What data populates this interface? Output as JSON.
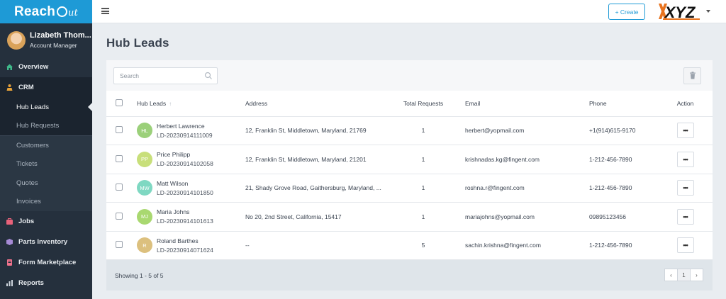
{
  "brand": {
    "name_part1": "Reach",
    "name_part2": "ut"
  },
  "user": {
    "name": "Lizabeth Thom...",
    "role": "Account Manager"
  },
  "nav": {
    "overview": "Overview",
    "crm": "CRM",
    "crm_sub": [
      "Hub Leads",
      "Hub Requests"
    ],
    "crm_other": [
      "Customers",
      "Tickets",
      "Quotes",
      "Invoices"
    ],
    "jobs": "Jobs",
    "parts": "Parts Inventory",
    "forms": "Form Marketplace",
    "reports": "Reports"
  },
  "topbar": {
    "create_label": "+ Create",
    "org_logo_text": "XYZ"
  },
  "page": {
    "title": "Hub Leads"
  },
  "search": {
    "placeholder": "Search"
  },
  "table": {
    "headers": {
      "lead": "Hub Leads",
      "address": "Address",
      "requests": "Total Requests",
      "email": "Email",
      "phone": "Phone",
      "action": "Action"
    },
    "rows": [
      {
        "initials": "HL",
        "color": "#9bd07a",
        "name": "Herbert Lawrence",
        "id": "LD-20230914111009",
        "address": "12, Franklin St, Middletown, Maryland, 21769",
        "requests": "1",
        "email": "herbert@yopmail.com",
        "phone": "+1(914)615-9170",
        "action": "•••"
      },
      {
        "initials": "PP",
        "color": "#c8df7a",
        "name": "Price Philipp",
        "id": "LD-20230914102058",
        "address": "12, Franklin St, Middletown, Maryland, 21201",
        "requests": "1",
        "email": "krishnadas.kg@fingent.com",
        "phone": "1-212-456-7890",
        "action": "•••"
      },
      {
        "initials": "MW",
        "color": "#7fd8c2",
        "name": "Matt Wilson",
        "id": "LD-20230914101850",
        "address": "21, Shady Grove Road, Gaithersburg, Maryland, ...",
        "requests": "1",
        "email": "roshna.r@fingent.com",
        "phone": "1-212-456-7890",
        "action": "•••"
      },
      {
        "initials": "MJ",
        "color": "#a9d870",
        "name": "Maria Johns",
        "id": "LD-20230914101613",
        "address": "No 20, 2nd Street, California, 15417",
        "requests": "1",
        "email": "mariajohns@yopmail.com",
        "phone": "09895123456",
        "action": "•••"
      },
      {
        "initials": "R",
        "color": "#dcc07e",
        "name": "Roland Barthes",
        "id": "LD-20230914071624",
        "address": "--",
        "requests": "5",
        "email": "sachin.krishna@fingent.com",
        "phone": "1-212-456-7890",
        "action": "•••"
      }
    ]
  },
  "footer": {
    "showing": "Showing 1 - 5 of 5",
    "page_prev": "‹",
    "page_current": "1",
    "page_next": "›"
  },
  "colors": {
    "accent": "#1e9ad6",
    "sidebar": "#25303d",
    "sidebar_active": "#1b242f"
  }
}
